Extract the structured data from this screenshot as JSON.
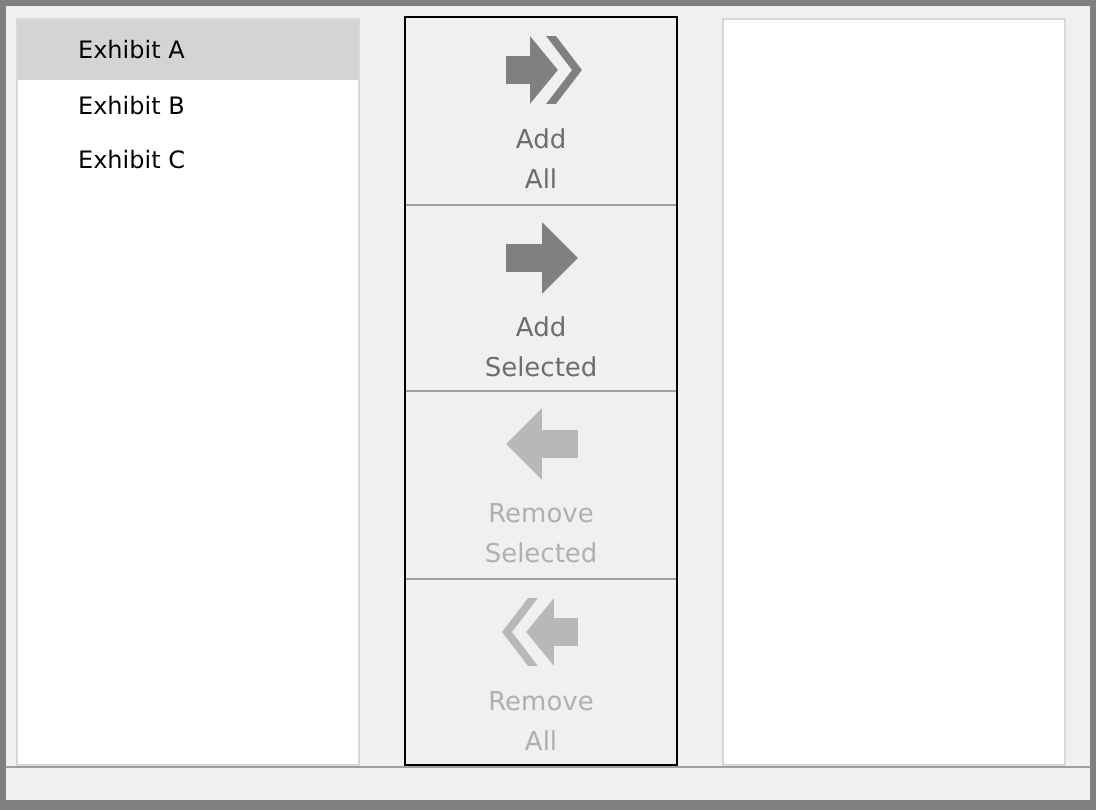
{
  "source_list": {
    "items": [
      {
        "label": "Exhibit A",
        "selected": true
      },
      {
        "label": "Exhibit B",
        "selected": false
      },
      {
        "label": "Exhibit C",
        "selected": false
      }
    ]
  },
  "buttons": [
    {
      "kind": "add_all",
      "label": "Add\nAll",
      "disabled": false
    },
    {
      "kind": "add",
      "label": "Add\nSelected",
      "disabled": false
    },
    {
      "kind": "remove",
      "label": "Remove\nSelected",
      "disabled": true
    },
    {
      "kind": "remove_all",
      "label": "Remove\nAll",
      "disabled": true
    }
  ]
}
